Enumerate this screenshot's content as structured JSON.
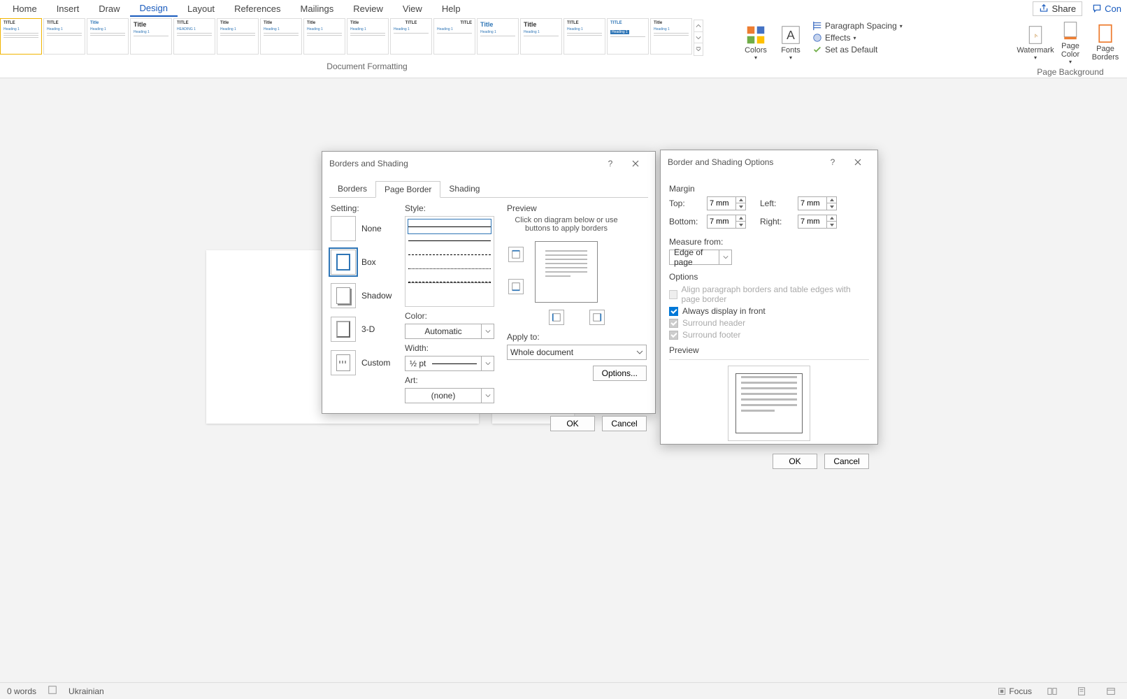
{
  "ribbon": {
    "tabs": [
      "Home",
      "Insert",
      "Draw",
      "Design",
      "Layout",
      "References",
      "Mailings",
      "Review",
      "View",
      "Help"
    ],
    "active_tab": "Design",
    "share": "Share",
    "comments": "Con",
    "group_doc_formatting": "Document Formatting",
    "group_page_bg": "Page Background",
    "colors_label": "Colors",
    "fonts_label": "Fonts",
    "paragraph_spacing": "Paragraph Spacing",
    "effects": "Effects",
    "set_default": "Set as Default",
    "watermark": "Watermark",
    "page_color": "Page Color",
    "page_borders": "Page Borders"
  },
  "dialog_borders": {
    "title": "Borders and Shading",
    "tabs": {
      "borders": "Borders",
      "page": "Page Border",
      "shading": "Shading"
    },
    "active_tab": "Page Border",
    "setting_label": "Setting:",
    "settings": {
      "none": "None",
      "box": "Box",
      "shadow": "Shadow",
      "threed": "3-D",
      "custom": "Custom"
    },
    "selected_setting": "box",
    "style_label": "Style:",
    "color_label": "Color:",
    "color_value": "Automatic",
    "width_label": "Width:",
    "width_value": "½ pt",
    "art_label": "Art:",
    "art_value": "(none)",
    "preview_label": "Preview",
    "preview_hint": "Click on diagram below or use buttons to apply borders",
    "apply_label": "Apply to:",
    "apply_value": "Whole document",
    "options_button": "Options...",
    "ok": "OK",
    "cancel": "Cancel"
  },
  "dialog_options": {
    "title": "Border and Shading Options",
    "margin_label": "Margin",
    "top_label": "Top:",
    "bottom_label": "Bottom:",
    "left_label": "Left:",
    "right_label": "Right:",
    "top": "7 mm",
    "bottom": "7 mm",
    "left": "7 mm",
    "right": "7 mm",
    "measure_label": "Measure from:",
    "measure_value": "Edge of page",
    "options_label": "Options",
    "align_para": "Align paragraph borders and table edges with page border",
    "always_front": "Always display in front",
    "surround_header": "Surround header",
    "surround_footer": "Surround footer",
    "always_front_checked": true,
    "preview_label": "Preview",
    "ok": "OK",
    "cancel": "Cancel"
  },
  "status": {
    "words": "0 words",
    "language": "Ukrainian",
    "focus": "Focus"
  }
}
